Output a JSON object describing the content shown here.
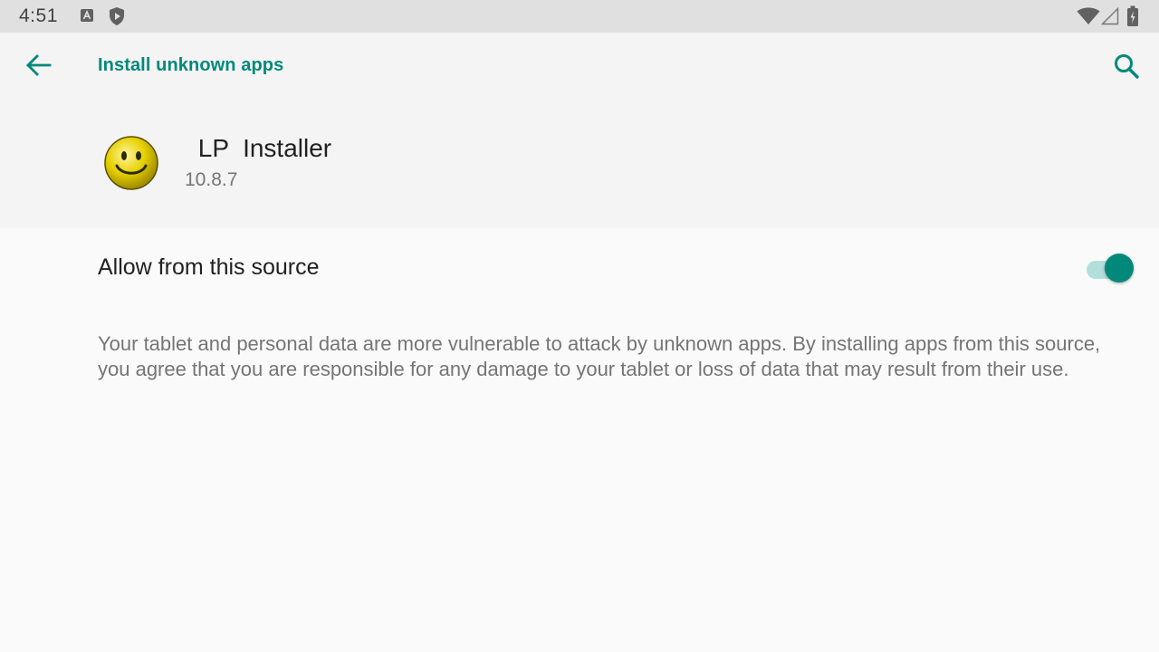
{
  "status_bar": {
    "time": "4:51",
    "left_icons": [
      "a-notification-icon",
      "shield-play-icon"
    ],
    "right_icons": [
      "wifi-icon",
      "cell-signal-icon",
      "battery-charging-icon"
    ]
  },
  "app_bar": {
    "title": "Install unknown apps",
    "back_icon": "arrow-back-icon",
    "search_icon": "search-icon"
  },
  "app": {
    "name": " LP  Installer",
    "version": "10.8.7",
    "icon": "smiley-face-icon"
  },
  "setting": {
    "label": "Allow from this source",
    "enabled": true
  },
  "warning": {
    "text": "Your tablet and personal data are more vulnerable to attack by unknown apps. By installing apps from this source, you agree that you are responsible for any damage to your tablet or loss of data that may result from their use."
  },
  "colors": {
    "accent": "#00897b",
    "accent_light": "#b2dfdb",
    "status_bar_bg": "#e0e0e0",
    "header_bg": "#f4f4f4",
    "page_bg": "#fafafa",
    "primary_text": "#212121",
    "secondary_text": "#757575"
  }
}
